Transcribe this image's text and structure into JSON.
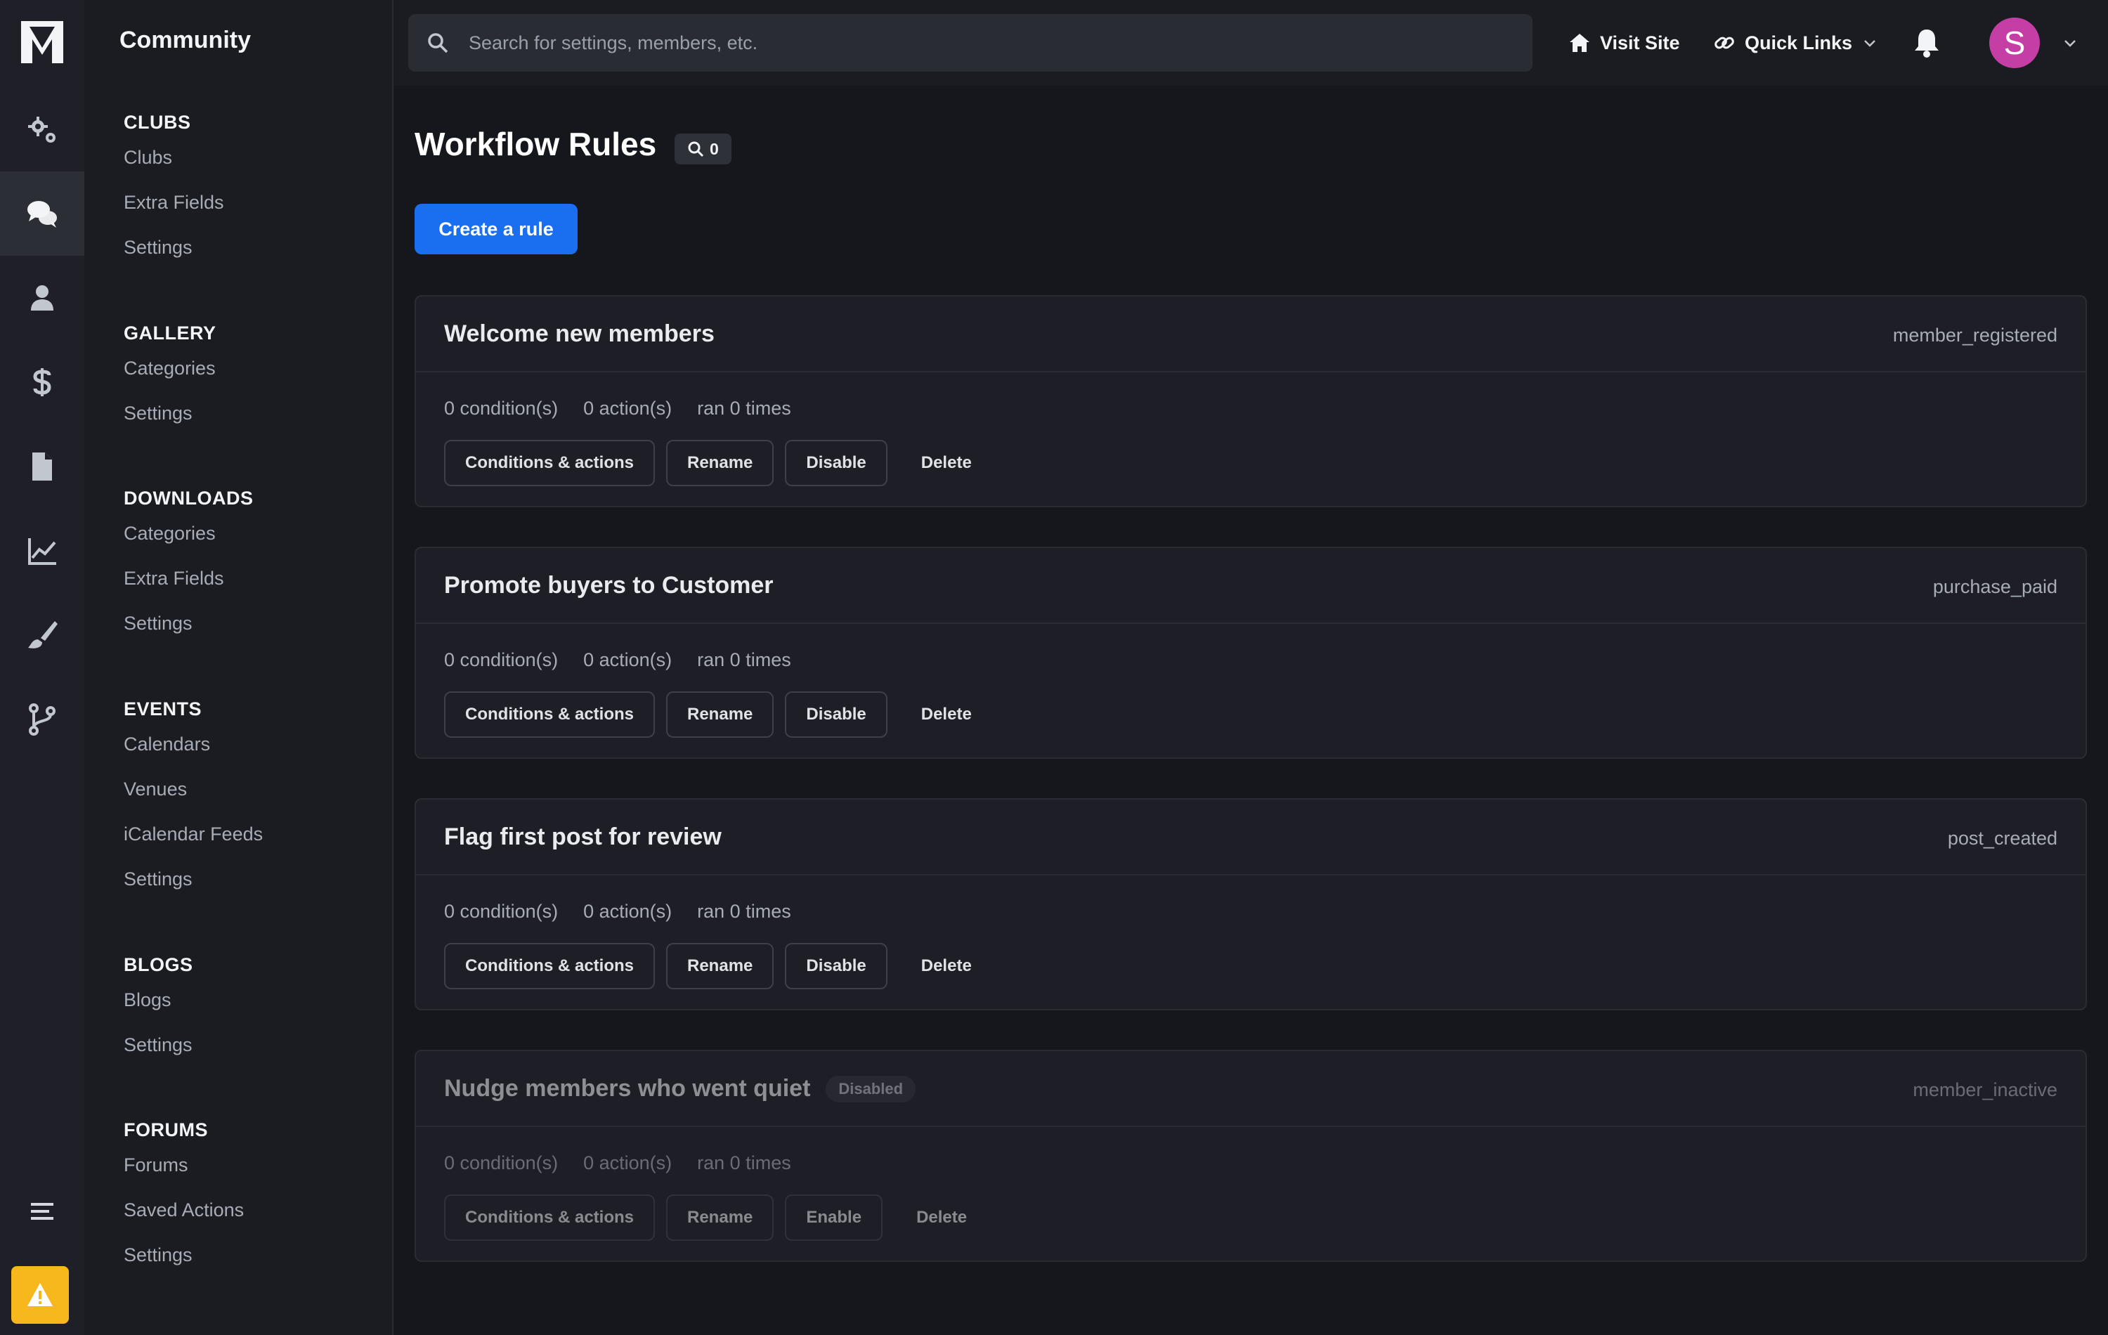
{
  "app": {
    "section_title": "Community"
  },
  "rail": {
    "items": [
      {
        "icon": "gears-icon"
      },
      {
        "icon": "comments-icon",
        "active": true
      },
      {
        "icon": "user-icon"
      },
      {
        "icon": "dollar-icon"
      },
      {
        "icon": "file-icon"
      },
      {
        "icon": "chart-line-icon"
      },
      {
        "icon": "paint-brush-icon"
      },
      {
        "icon": "code-branch-icon"
      }
    ],
    "alert_color": "#f7b81d"
  },
  "subnav": {
    "groups": [
      {
        "title": "CLUBS",
        "links": [
          "Clubs",
          "Extra Fields",
          "Settings"
        ]
      },
      {
        "title": "GALLERY",
        "links": [
          "Categories",
          "Settings"
        ]
      },
      {
        "title": "DOWNLOADS",
        "links": [
          "Categories",
          "Extra Fields",
          "Settings"
        ]
      },
      {
        "title": "EVENTS",
        "links": [
          "Calendars",
          "Venues",
          "iCalendar Feeds",
          "Settings"
        ]
      },
      {
        "title": "BLOGS",
        "links": [
          "Blogs",
          "Settings"
        ]
      },
      {
        "title": "FORUMS",
        "links": [
          "Forums",
          "Saved Actions",
          "Settings"
        ]
      }
    ]
  },
  "topbar": {
    "search_placeholder": "Search for settings, members, etc.",
    "visit_site": "Visit Site",
    "quick_links": "Quick Links",
    "avatar_initial": "S",
    "avatar_color": "#c53ea6"
  },
  "main": {
    "title": "Workflow Rules",
    "search_count": "0",
    "create_button": "Create a rule",
    "accent_color": "#1a6ef0",
    "rules": [
      {
        "name": "Welcome new members",
        "trigger": "member_registered",
        "conditions": "0 condition(s)",
        "actions": "0 action(s)",
        "runs": "ran 0 times",
        "buttons": {
          "conditions": "Conditions & actions",
          "rename": "Rename",
          "toggle": "Disable",
          "delete": "Delete"
        },
        "disabled": false
      },
      {
        "name": "Promote buyers to Customer",
        "trigger": "purchase_paid",
        "conditions": "0 condition(s)",
        "actions": "0 action(s)",
        "runs": "ran 0 times",
        "buttons": {
          "conditions": "Conditions & actions",
          "rename": "Rename",
          "toggle": "Disable",
          "delete": "Delete"
        },
        "disabled": false
      },
      {
        "name": "Flag first post for review",
        "trigger": "post_created",
        "conditions": "0 condition(s)",
        "actions": "0 action(s)",
        "runs": "ran 0 times",
        "buttons": {
          "conditions": "Conditions & actions",
          "rename": "Rename",
          "toggle": "Disable",
          "delete": "Delete"
        },
        "disabled": false
      },
      {
        "name": "Nudge members who went quiet",
        "badge": "Disabled",
        "trigger": "member_inactive",
        "conditions": "0 condition(s)",
        "actions": "0 action(s)",
        "runs": "ran 0 times",
        "buttons": {
          "conditions": "Conditions & actions",
          "rename": "Rename",
          "toggle": "Enable",
          "delete": "Delete"
        },
        "disabled": true
      }
    ]
  }
}
